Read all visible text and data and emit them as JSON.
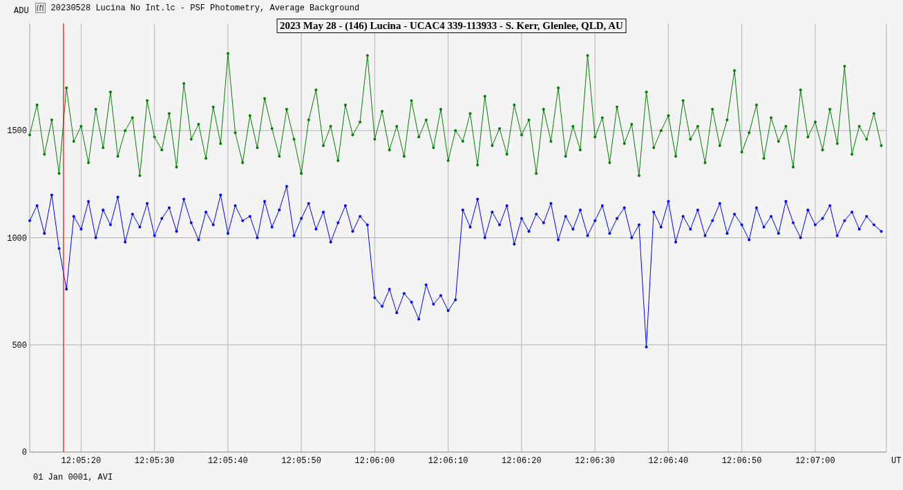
{
  "window": {
    "title": "20230528 Lucina No Int.lc - PSF Photometry, Average Background"
  },
  "chart": {
    "chart_data": {
      "type": "line",
      "title": "2023 May 28 - (146) Lucina - UCAC4 339-113933 - S. Kerr, Glenlee, QLD, AU",
      "xlabel": "UT",
      "ylabel": "ADU",
      "categories": [
        null,
        null,
        null,
        null,
        null,
        null,
        null,
        "12:05:20",
        null,
        null,
        null,
        null,
        null,
        null,
        null,
        null,
        null,
        "12:05:30",
        null,
        null,
        null,
        null,
        null,
        null,
        null,
        null,
        null,
        "12:05:40",
        null,
        null,
        null,
        null,
        null,
        null,
        null,
        null,
        null,
        "12:05:50",
        null,
        null,
        null,
        null,
        null,
        null,
        null,
        null,
        null,
        "12:06:00",
        null,
        null,
        null,
        null,
        null,
        null,
        null,
        null,
        null,
        "12:06:10",
        null,
        null,
        null,
        null,
        null,
        null,
        null,
        null,
        null,
        "12:06:20",
        null,
        null,
        null,
        null,
        null,
        null,
        null,
        null,
        null,
        "12:06:30",
        null,
        null,
        null,
        null,
        null,
        null,
        null,
        null,
        null,
        "12:06:40",
        null,
        null,
        null,
        null,
        null,
        null,
        null,
        null,
        null,
        "12:06:50",
        null,
        null,
        null,
        null,
        null,
        null,
        null,
        null,
        null,
        "12:07:00",
        null,
        null,
        null,
        null,
        null,
        null,
        null,
        null,
        null
      ],
      "series": [
        {
          "color": "#008000",
          "values": [
            1480,
            1620,
            1390,
            1550,
            1300,
            1700,
            1450,
            1520,
            1350,
            1600,
            1420,
            1680,
            1380,
            1500,
            1560,
            1290,
            1640,
            1470,
            1410,
            1580,
            1330,
            1720,
            1460,
            1530,
            1370,
            1610,
            1440,
            1860,
            1490,
            1350,
            1570,
            1420,
            1650,
            1510,
            1380,
            1600,
            1460,
            1300,
            1550,
            1690,
            1430,
            1520,
            1360,
            1620,
            1480,
            1540,
            1850,
            1460,
            1590,
            1410,
            1520,
            1380,
            1640,
            1470,
            1550,
            1420,
            1600,
            1360,
            1500,
            1450,
            1580,
            1340,
            1660,
            1430,
            1510,
            1390,
            1620,
            1480,
            1550,
            1300,
            1600,
            1450,
            1700,
            1380,
            1520,
            1410,
            1850,
            1470,
            1560,
            1350,
            1610,
            1440,
            1530,
            1290,
            1680,
            1420,
            1500,
            1570,
            1380,
            1640,
            1460,
            1520,
            1350,
            1600,
            1430,
            1550,
            1780,
            1400,
            1490,
            1620,
            1370,
            1560,
            1450,
            1520,
            1330,
            1690,
            1470,
            1540,
            1410,
            1600,
            1440,
            1800,
            1390,
            1520,
            1460,
            1580,
            1430
          ]
        },
        {
          "color": "#0000ff",
          "values": [
            1080,
            1150,
            1020,
            1200,
            950,
            760,
            1100,
            1040,
            1170,
            1000,
            1130,
            1060,
            1190,
            980,
            1110,
            1050,
            1160,
            1010,
            1090,
            1140,
            1030,
            1180,
            1070,
            990,
            1120,
            1060,
            1200,
            1020,
            1150,
            1080,
            1100,
            1000,
            1170,
            1050,
            1130,
            1240,
            1010,
            1090,
            1160,
            1040,
            1120,
            980,
            1070,
            1150,
            1030,
            1100,
            1060,
            720,
            680,
            760,
            650,
            740,
            700,
            620,
            780,
            690,
            730,
            660,
            710,
            1130,
            1050,
            1180,
            1000,
            1120,
            1060,
            1150,
            970,
            1090,
            1030,
            1110,
            1070,
            1160,
            990,
            1100,
            1040,
            1130,
            1010,
            1080,
            1150,
            1020,
            1090,
            1140,
            1000,
            1060,
            490,
            1120,
            1050,
            1170,
            980,
            1100,
            1040,
            1130,
            1010,
            1080,
            1160,
            1020,
            1110,
            1060,
            990,
            1140,
            1050,
            1100,
            1020,
            1170,
            1070,
            1000,
            1130,
            1060,
            1090,
            1150,
            1010,
            1080,
            1120,
            1040,
            1100,
            1060,
            1030
          ]
        }
      ],
      "ylim": [
        0,
        2000
      ],
      "yticks": [
        0,
        500,
        1000,
        1500
      ],
      "grid": true
    }
  },
  "footer": {
    "text": "01 Jan 0001, AVI"
  }
}
